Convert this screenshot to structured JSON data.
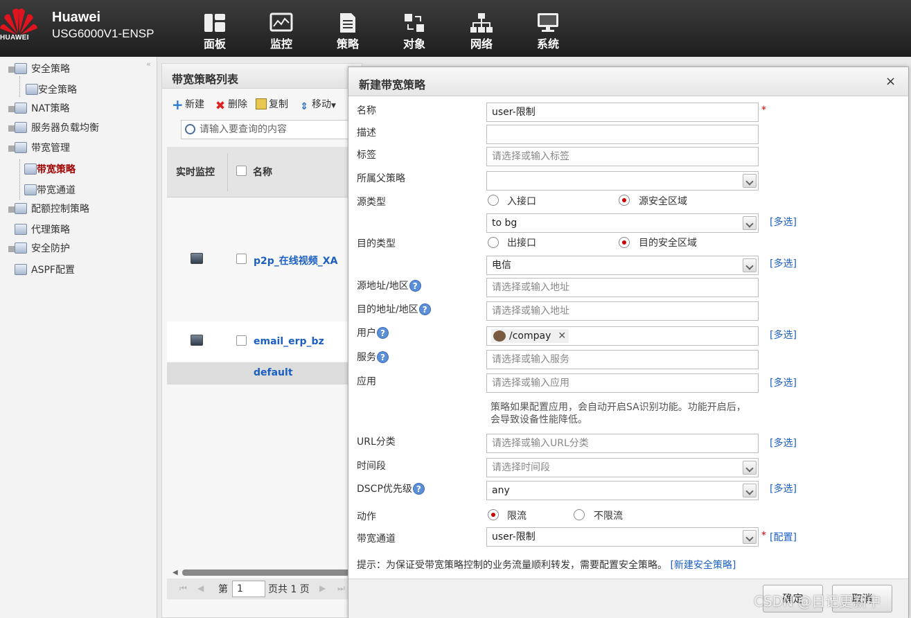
{
  "header": {
    "logo_text": "HUAWEI",
    "brand_name": "Huawei",
    "device_model": "USG6000V1-ENSP",
    "nav": [
      {
        "label": "面板",
        "icon": "dashboard-icon"
      },
      {
        "label": "监控",
        "icon": "monitor-icon"
      },
      {
        "label": "策略",
        "icon": "policy-icon"
      },
      {
        "label": "对象",
        "icon": "object-icon"
      },
      {
        "label": "网络",
        "icon": "network-icon"
      },
      {
        "label": "系统",
        "icon": "system-icon"
      }
    ]
  },
  "sidebar": {
    "collapse_glyph": "«",
    "items": [
      {
        "label": "安全策略",
        "level": 0
      },
      {
        "label": "安全策略",
        "level": 1
      },
      {
        "label": "NAT策略",
        "level": 0
      },
      {
        "label": "服务器负载均衡",
        "level": 0
      },
      {
        "label": "带宽管理",
        "level": 0
      },
      {
        "label": "带宽策略",
        "level": 1,
        "active": true
      },
      {
        "label": "带宽通道",
        "level": 1
      },
      {
        "label": "配额控制策略",
        "level": 0
      },
      {
        "label": "代理策略",
        "level": 0
      },
      {
        "label": "安全防护",
        "level": 0
      },
      {
        "label": "ASPF配置",
        "level": 0
      }
    ]
  },
  "list_panel": {
    "title": "带宽策略列表",
    "toolbar": {
      "new": "新建",
      "delete": "删除",
      "copy": "复制",
      "move": "移动"
    },
    "search_placeholder": "请输入要查询的内容",
    "columns": {
      "monitor": "实时监控",
      "name": "名称"
    },
    "rows": [
      {
        "name": "p2p_在线视频_XA"
      },
      {
        "name": "email_erp_bz"
      },
      {
        "name": "default"
      }
    ],
    "pager": {
      "prefix": "第",
      "page": "1",
      "suffix": "页共 1 页"
    }
  },
  "dialog": {
    "title": "新建带宽策略",
    "close": "×",
    "required_mark": "*",
    "multi_select": "[多选]",
    "fields": {
      "name": {
        "label": "名称",
        "value": "user-限制"
      },
      "description": {
        "label": "描述",
        "value": ""
      },
      "tag": {
        "label": "标签",
        "placeholder": "请选择或输入标签"
      },
      "parent_policy": {
        "label": "所属父策略",
        "value": ""
      },
      "source_type": {
        "label": "源类型",
        "option_a": "入接口",
        "option_b": "源安全区域",
        "selected": "源安全区域"
      },
      "source_zone": {
        "value": "to bg"
      },
      "dest_type": {
        "label": "目的类型",
        "option_a": "出接口",
        "option_b": "目的安全区域",
        "selected": "目的安全区域"
      },
      "dest_zone": {
        "value": "电信"
      },
      "source_address": {
        "label": "源地址/地区",
        "placeholder": "请选择或输入地址"
      },
      "dest_address": {
        "label": "目的地址/地区",
        "placeholder": "请选择或输入地址"
      },
      "user": {
        "label": "用户",
        "tag": "/compay",
        "tag_remove": "✕"
      },
      "service": {
        "label": "服务",
        "placeholder": "请选择或输入服务"
      },
      "application": {
        "label": "应用",
        "placeholder": "请选择或输入应用",
        "note": "策略如果配置应用，会自动开启SA识别功能。功能开启后，会导致设备性能降低。"
      },
      "url_category": {
        "label": "URL分类",
        "placeholder": "请选择或输入URL分类"
      },
      "time_range": {
        "label": "时间段",
        "placeholder": "请选择时间段"
      },
      "dscp": {
        "label": "DSCP优先级",
        "value": "any"
      },
      "action": {
        "label": "动作",
        "option_a": "限流",
        "option_b": "不限流",
        "selected": "限流"
      },
      "bandwidth_channel": {
        "label": "带宽通道",
        "value": "user-限制",
        "config_link": "[配置]"
      }
    },
    "hint": "提示：为保证受带宽策略控制的业务流量顺利转发，需要配置安全策略。",
    "hint_link": "[新建安全策略]",
    "buttons": {
      "ok": "确定",
      "cancel": "取消"
    }
  },
  "watermark": "CSDN @日记更新中"
}
